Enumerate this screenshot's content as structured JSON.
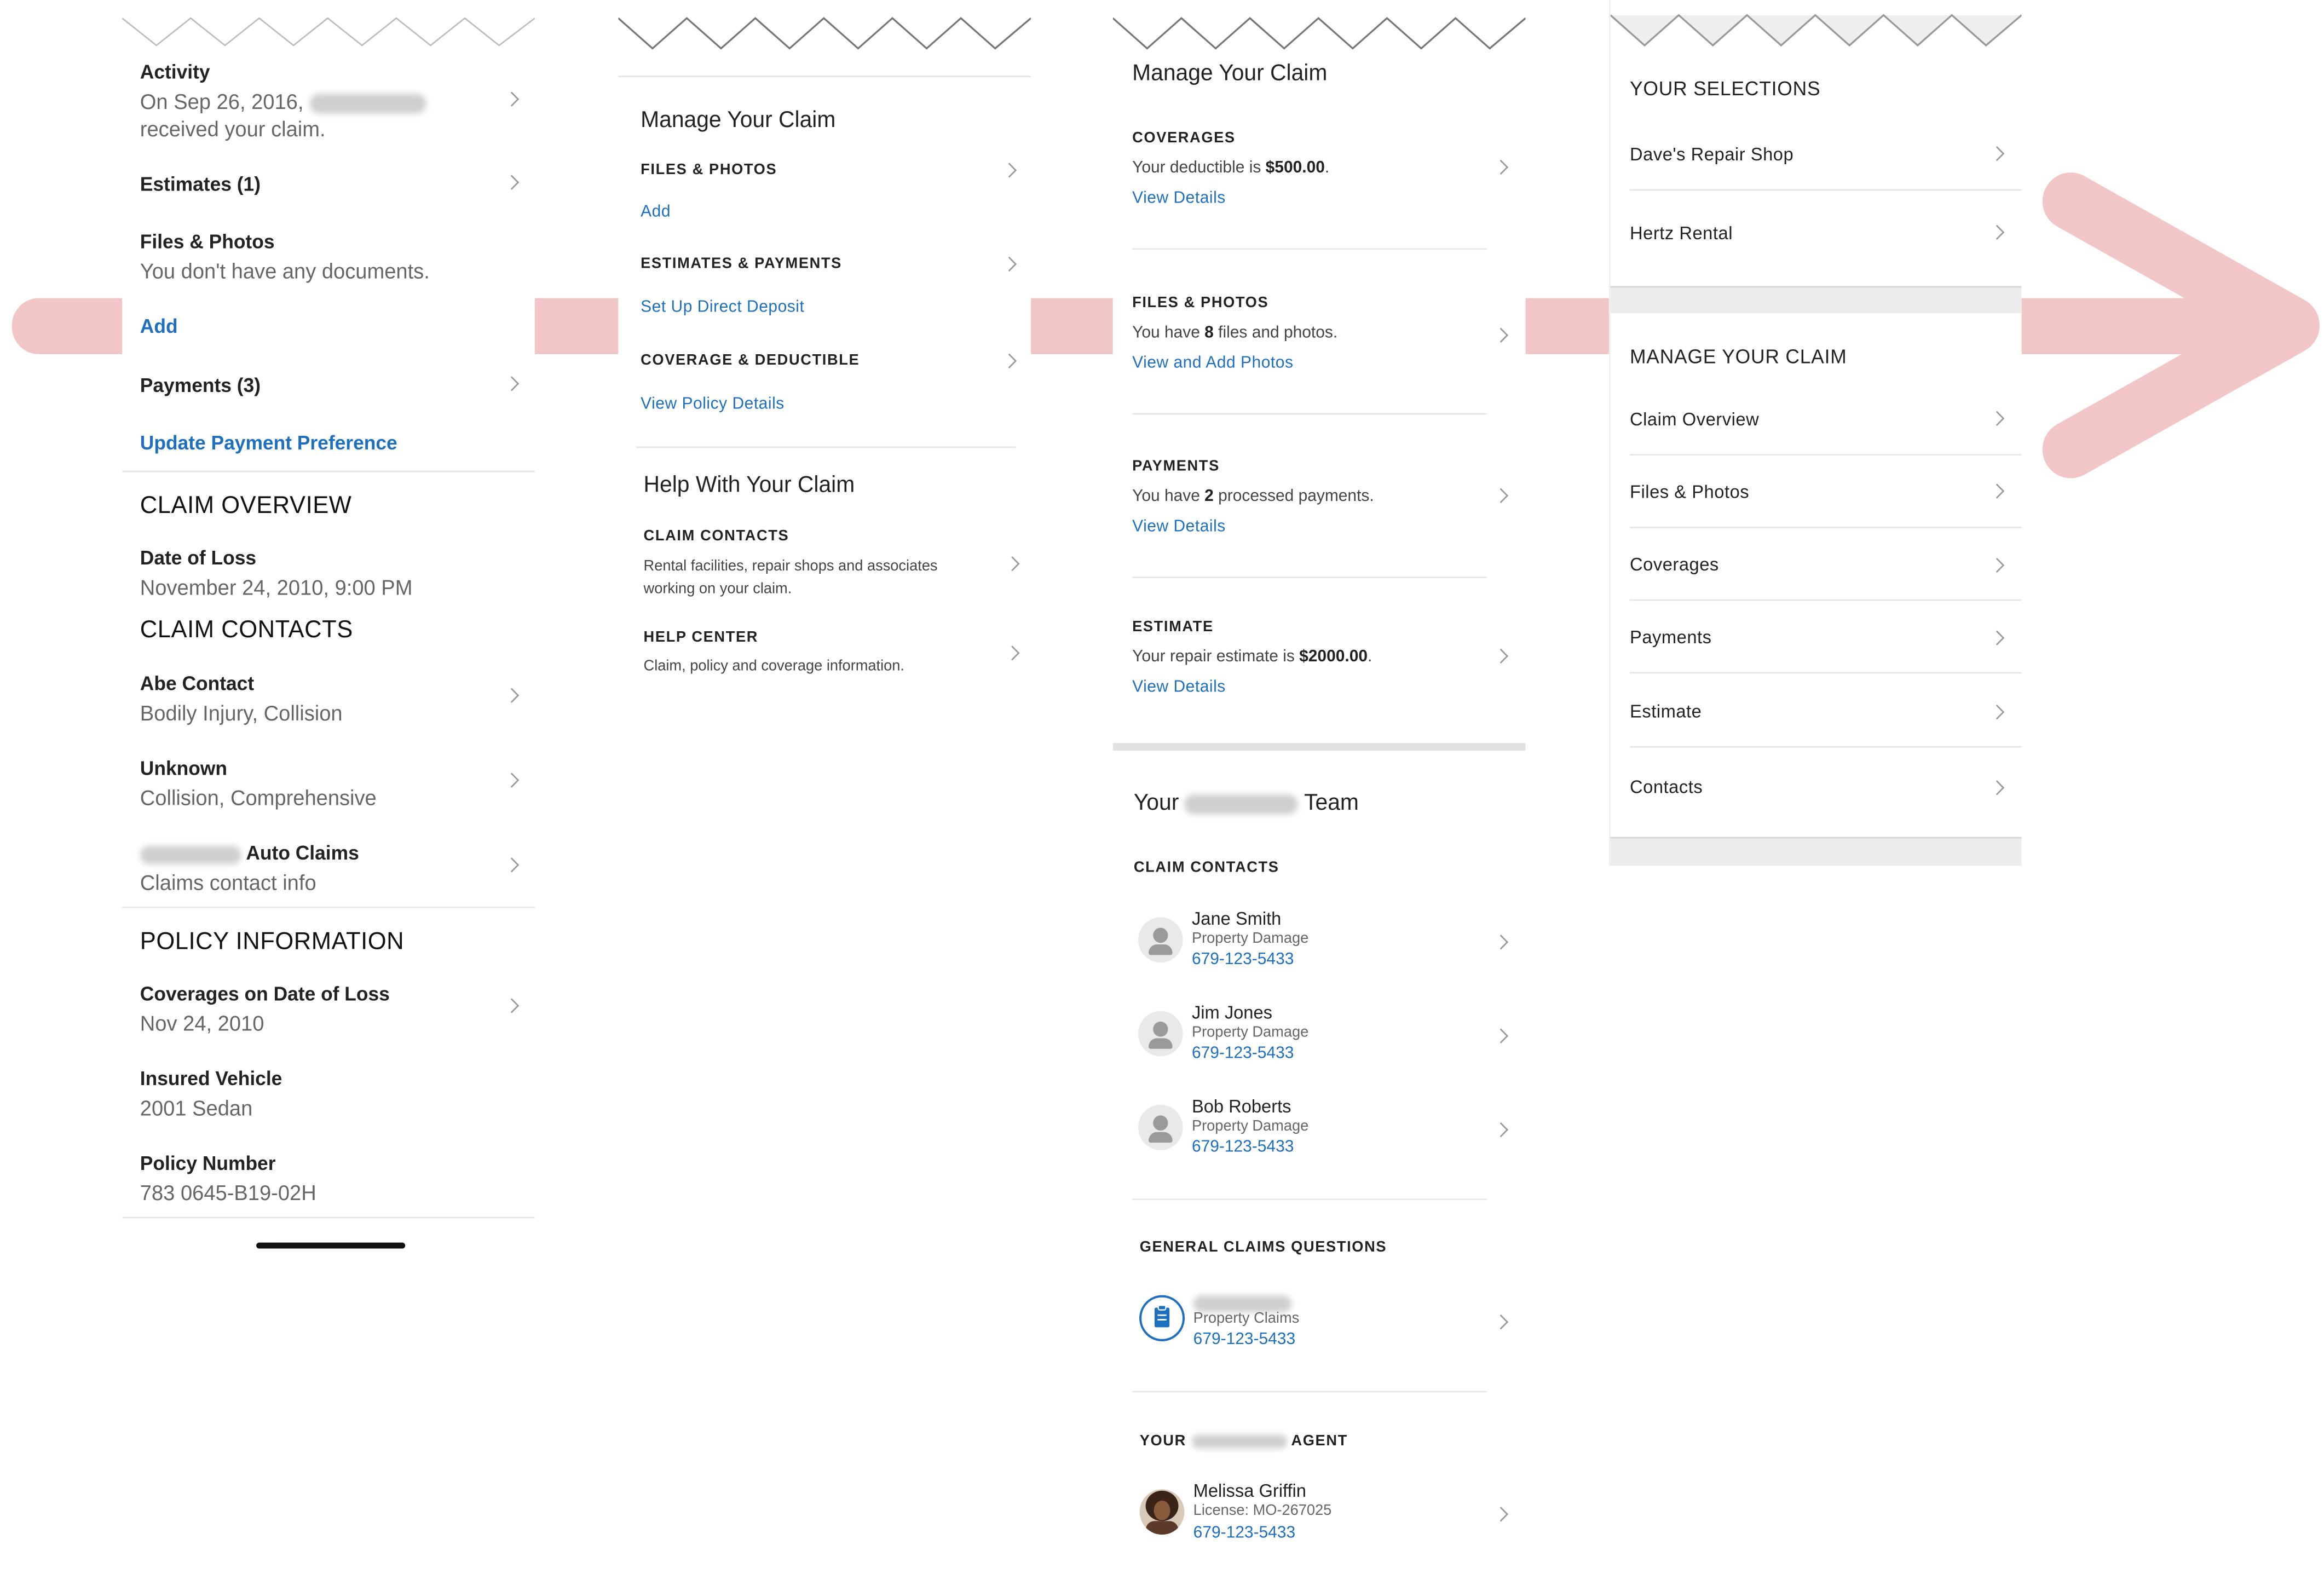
{
  "screen1": {
    "activity": {
      "title": "Activity",
      "text_pre": "On Sep 26, 2016,",
      "text_post": "received your claim."
    },
    "estimates": {
      "title": "Estimates (1)"
    },
    "files": {
      "title": "Files & Photos",
      "text": "You don't have any documents.",
      "add": "Add"
    },
    "payments": {
      "title": "Payments (3)",
      "link": "Update Payment Preference"
    },
    "claim_overview": {
      "heading": "CLAIM OVERVIEW",
      "date_label": "Date of Loss",
      "date_value": "November 24, 2010, 9:00 PM"
    },
    "claim_contacts": {
      "heading": "CLAIM CONTACTS",
      "items": [
        {
          "name": "Abe Contact",
          "detail": "Bodily Injury, Collision"
        },
        {
          "name": "Unknown",
          "detail": "Collision, Comprehensive"
        },
        {
          "name": "Auto Claims",
          "detail": "Claims contact info"
        }
      ]
    },
    "policy": {
      "heading": "POLICY INFORMATION",
      "coverages_label": "Coverages on Date of Loss",
      "coverages_value": "Nov 24, 2010",
      "vehicle_label": "Insured Vehicle",
      "vehicle_value": "2001 Sedan",
      "number_label": "Policy Number",
      "number_value": "783 0645-B19-02H"
    }
  },
  "screen2": {
    "title": "Manage Your Claim",
    "sections": [
      {
        "caption": "FILES & PHOTOS",
        "link": "Add"
      },
      {
        "caption": "ESTIMATES & PAYMENTS",
        "link": "Set Up Direct Deposit"
      },
      {
        "caption": "COVERAGE & DEDUCTIBLE",
        "link": "View Policy Details"
      }
    ],
    "help_title": "Help With Your Claim",
    "help": [
      {
        "caption": "CLAIM CONTACTS",
        "text1": "Rental facilities, repair shops and associates",
        "text2": "working on your claim."
      },
      {
        "caption": "HELP CENTER",
        "text1": "Claim, policy and coverage information."
      }
    ]
  },
  "screen3": {
    "title": "Manage Your Claim",
    "cards": [
      {
        "caption": "COVERAGES",
        "pre": "Your deductible is ",
        "bold": "$500.00",
        "post": ".",
        "link": "View Details"
      },
      {
        "caption": "FILES & PHOTOS",
        "pre": "You have ",
        "bold": "8",
        "post": " files and photos.",
        "link": "View and Add Photos"
      },
      {
        "caption": "PAYMENTS",
        "pre": "You have ",
        "bold": "2",
        "post": " processed payments.",
        "link": "View Details"
      },
      {
        "caption": "ESTIMATE",
        "pre": "Your repair estimate is ",
        "bold": "$2000.00",
        "post": ".",
        "link": "View Details"
      }
    ],
    "team_title_pre": "Your",
    "team_title_post": "Team",
    "contacts_caption": "CLAIM CONTACTS",
    "contacts": [
      {
        "name": "Jane Smith",
        "role": "Property Damage",
        "phone": "679-123-5433"
      },
      {
        "name": "Jim Jones",
        "role": "Property Damage",
        "phone": "679-123-5433"
      },
      {
        "name": "Bob Roberts",
        "role": "Property Damage",
        "phone": "679-123-5433"
      }
    ],
    "general_caption": "GENERAL CLAIMS QUESTIONS",
    "general": {
      "role": "Property Claims",
      "phone": "679-123-5433"
    },
    "agent_caption_pre": "YOUR",
    "agent_caption_post": "AGENT",
    "agent": {
      "name": "Melissa Griffin",
      "license": "License: MO-267025",
      "phone": "679-123-5433"
    }
  },
  "screen4": {
    "selections_caption": "YOUR SELECTIONS",
    "selections": [
      "Dave's Repair Shop",
      "Hertz Rental"
    ],
    "manage_caption": "MANAGE YOUR CLAIM",
    "manage": [
      "Claim Overview",
      "Files & Photos",
      "Coverages",
      "Payments",
      "Estimate",
      "Contacts"
    ]
  },
  "colors": {
    "link": "#1e6fc0",
    "band": "#f2c6c6"
  }
}
